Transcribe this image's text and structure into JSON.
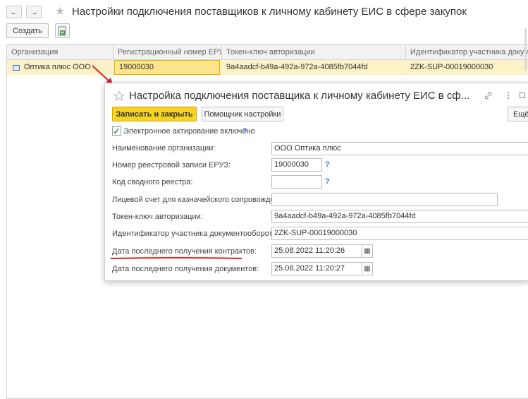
{
  "window": {
    "title": "Настройки подключения поставщиков к личному кабинету ЕИС в сфере закупок",
    "back_icon": "←",
    "forward_icon": "→",
    "star_icon": "★"
  },
  "toolbar": {
    "create_label": "Создать"
  },
  "table": {
    "columns": [
      "Организация",
      "Регистрационный номер ЕРУЗ",
      "Токен-ключ авторизации",
      "Идентификатор участника документ"
    ],
    "rows": [
      {
        "organization": "Оптика плюс ООО",
        "reg_number": "19000030",
        "token": "9a4aadcf-b49a-492a-972a-4085fb7044fd",
        "participant_id": "2ZK-SUP-00019000030"
      }
    ]
  },
  "dialog": {
    "title": "Настройка подключения поставщика к личному кабинету ЕИС в сф...",
    "save_close_label": "Записать и закрыть",
    "assistant_label": "Помощник настройки",
    "more_label": "Ещё",
    "checkbox_label": "Электронное актирование включено",
    "checkbox_checked": true,
    "help_mark": "?",
    "fields": {
      "org_name_label": "Наименование организации:",
      "org_name_value": "ООО Оптика плюс",
      "reg_record_label": "Номер реестровой записи ЕРУЗ:",
      "reg_record_value": "19000030",
      "summary_code_label": "Код сводного реестра:",
      "summary_code_value": "",
      "personal_account_label": "Лицевой счет для казначейского сопровождения:",
      "personal_account_value": "",
      "token_label": "Токен-ключ авторизации:",
      "token_value": "9a4aadcf-b49a-492a-972a-4085fb7044fd",
      "participant_label": "Идентификатор участника документооборота:",
      "participant_value": "2ZK-SUP-00019000030",
      "contracts_date_label": "Дата последнего получения контрактов:",
      "contracts_date_value": "25.08.2022 11:20:26",
      "documents_date_label": "Дата последнего получения документов:",
      "documents_date_value": "25.08.2022 11:20:27"
    }
  },
  "colors": {
    "accent_yellow": "#f8d320",
    "selected_row": "#fdf1c7",
    "annotation_red": "#e32020",
    "help_blue": "#2f7bd6"
  }
}
